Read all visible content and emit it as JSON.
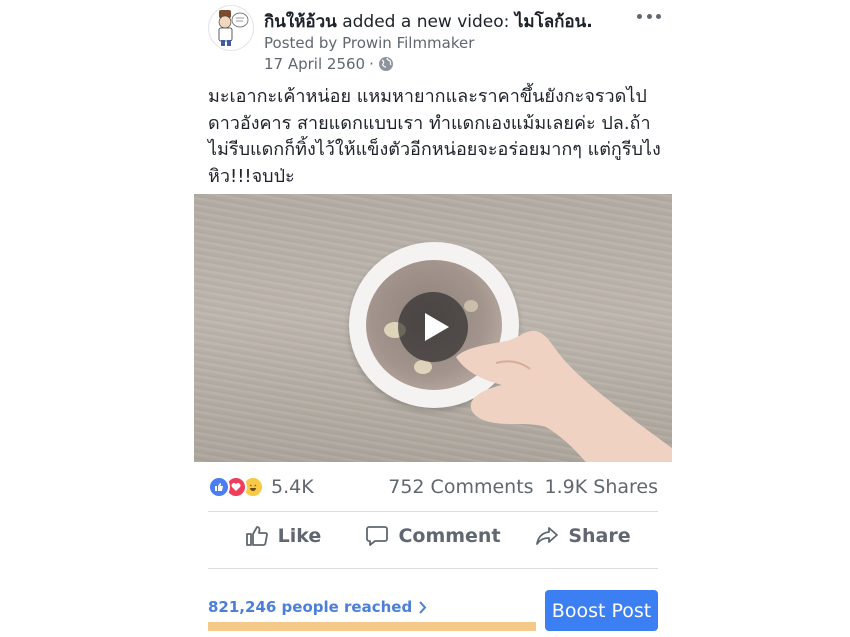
{
  "post": {
    "page_name": "กินให้อ้วน",
    "action_text": "added a new video:",
    "video_title": "ไมโลก้อน.",
    "posted_by": "Posted by Prowin Filmmaker",
    "date": "17 April 2560",
    "separator": "·",
    "privacy_icon": "globe-icon",
    "text": "มะเอากะเค้าหน่อย แหมหายากและราคาขึ้นยังกะจรวดไปดาวอังคาร สายแดกแบบเรา ทำแดกเองแม้มเลยค่ะ ปล.ถ้าไม่รีบแดกก็ทิ้งไว้ให้แข็งตัวอีกหน่อยจะอร่อยมากๆ แต่กูรีบไง หิว!!!จบป่ะ"
  },
  "video": {
    "play_icon": "play-icon"
  },
  "stats": {
    "reactions_count": "5.4K",
    "comments": "752 Comments",
    "shares": "1.9K Shares"
  },
  "actions": {
    "like": "Like",
    "comment": "Comment",
    "share": "Share"
  },
  "reach": {
    "text": "821,246 people reached"
  },
  "boost_button": "Boost Post",
  "colors": {
    "accent": "#3b7ff2",
    "reach_text": "#4b7fd9",
    "reach_bar": "#f5c98a",
    "like": "#4a7ef2",
    "love": "#f03d5c",
    "haha": "#f7c944"
  }
}
